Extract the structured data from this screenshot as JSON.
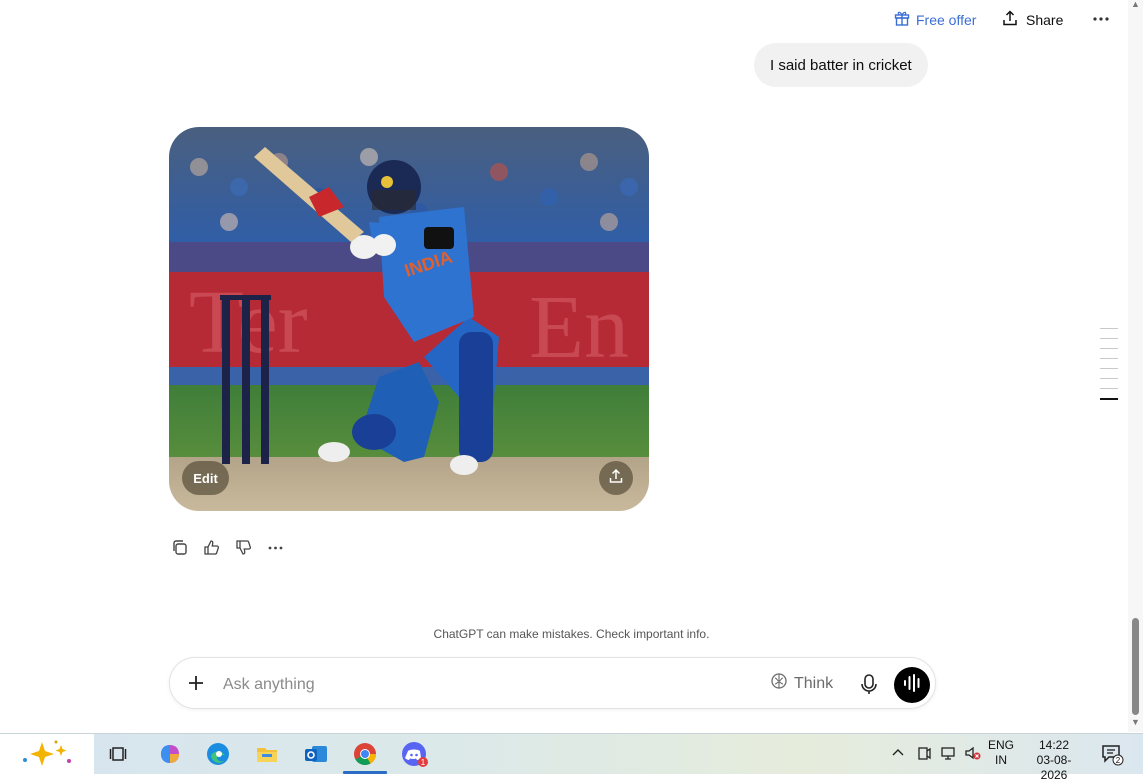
{
  "header": {
    "free_offer": "Free offer",
    "share": "Share",
    "more_icon": "ellipsis-icon"
  },
  "conversation": {
    "user_message": "I said batter in cricket",
    "image_edit_label": "Edit",
    "image_logo_text": "INDIA"
  },
  "message_actions": [
    "copy-icon",
    "thumbs-up-icon",
    "thumbs-down-icon",
    "more-icon"
  ],
  "disclaimer": "ChatGPT can make mistakes. Check important info.",
  "composer": {
    "placeholder": "Ask anything",
    "think_label": "Think"
  },
  "taskbar": {
    "apps": [
      "copilot",
      "task-view",
      "microsoft-365",
      "edge",
      "file-explorer",
      "outlook",
      "chrome",
      "discord"
    ],
    "discord_badge": "1",
    "language_line1": "ENG",
    "language_line2": "IN",
    "time": "14:22",
    "date": "03-08-2026",
    "notification_count": "2"
  },
  "colors": {
    "accent": "#3b6ed6",
    "taskbar_active": "#2b6cc4"
  }
}
